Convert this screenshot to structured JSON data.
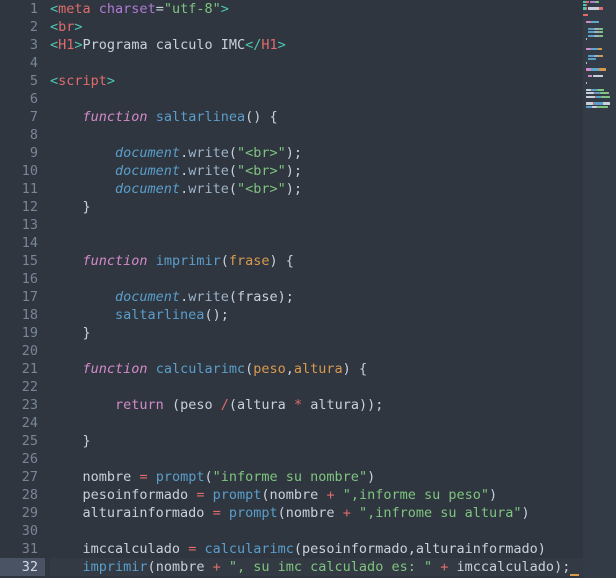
{
  "editor": {
    "name": "code-editor",
    "language": "html",
    "theme": "dark-slate",
    "total_lines": 32,
    "active_line": 32,
    "colors": {
      "background": "#2f3640",
      "gutter_text": "#7a8596",
      "active_line_number_bg": "#4a5364",
      "minimap_background": "#333b47",
      "cursor": "#d99a4e",
      "tag_bracket": "#4ec9b0",
      "tag_name": "#e06c6c",
      "attribute": "#b07ad6",
      "string": "#7fc47f",
      "keyword": "#d38ac9",
      "function_name": "#5fa8c9",
      "parameter": "#d99a4e",
      "operator": "#e06c6c",
      "plain_text": "#c8d0db"
    }
  },
  "line_numbers": [
    1,
    2,
    3,
    4,
    5,
    6,
    7,
    8,
    9,
    10,
    11,
    12,
    13,
    14,
    15,
    16,
    17,
    18,
    19,
    20,
    21,
    22,
    23,
    24,
    25,
    26,
    27,
    28,
    29,
    30,
    31,
    32
  ],
  "code_lines": [
    {
      "n": 1,
      "text": "<meta charset=\"utf-8\">"
    },
    {
      "n": 2,
      "text": "<br>"
    },
    {
      "n": 3,
      "text": "<H1>Programa calculo IMC</H1>"
    },
    {
      "n": 4,
      "text": ""
    },
    {
      "n": 5,
      "text": "<script>"
    },
    {
      "n": 6,
      "text": ""
    },
    {
      "n": 7,
      "text": "    function saltarlinea() {"
    },
    {
      "n": 8,
      "text": ""
    },
    {
      "n": 9,
      "text": "        document.write(\"<br>\");"
    },
    {
      "n": 10,
      "text": "        document.write(\"<br>\");"
    },
    {
      "n": 11,
      "text": "        document.write(\"<br>\");"
    },
    {
      "n": 12,
      "text": "    }"
    },
    {
      "n": 13,
      "text": ""
    },
    {
      "n": 14,
      "text": ""
    },
    {
      "n": 15,
      "text": "    function imprimir(frase) {"
    },
    {
      "n": 16,
      "text": ""
    },
    {
      "n": 17,
      "text": "        document.write(frase);"
    },
    {
      "n": 18,
      "text": "        saltarlinea();"
    },
    {
      "n": 19,
      "text": "    }"
    },
    {
      "n": 20,
      "text": ""
    },
    {
      "n": 21,
      "text": "    function calcularimc(peso,altura) {"
    },
    {
      "n": 22,
      "text": ""
    },
    {
      "n": 23,
      "text": "        return (peso /(altura * altura));"
    },
    {
      "n": 24,
      "text": ""
    },
    {
      "n": 25,
      "text": "    }"
    },
    {
      "n": 26,
      "text": ""
    },
    {
      "n": 27,
      "text": "    nombre = prompt(\"informe su nombre\")"
    },
    {
      "n": 28,
      "text": "    pesoinformado = prompt(nombre + \",informe su peso\")"
    },
    {
      "n": 29,
      "text": "    alturainformado = prompt(nombre + \",infrome su altura\")"
    },
    {
      "n": 30,
      "text": ""
    },
    {
      "n": 31,
      "text": "    imccalculado = calcularimc(pesoinformado,alturainformado)"
    },
    {
      "n": 32,
      "text": "    imprimir(nombre + \", su imc calculado es: \" + imccalculado);"
    }
  ],
  "minimap": {
    "name": "minimap",
    "visible_rows": 32,
    "rows": [
      [
        {
          "w": 3,
          "c": "#4ec9b0"
        },
        {
          "w": 4,
          "c": "#e06c6c"
        },
        {
          "w": 1,
          "c": "#2f3640"
        },
        {
          "w": 6,
          "c": "#b07ad6"
        },
        {
          "w": 5,
          "c": "#7fc47f"
        }
      ],
      [
        {
          "w": 3,
          "c": "#4ec9b0"
        },
        {
          "w": 2,
          "c": "#e06c6c"
        }
      ],
      [
        {
          "w": 3,
          "c": "#4ec9b0"
        },
        {
          "w": 2,
          "c": "#e06c6c"
        },
        {
          "w": 1,
          "c": "#2f3640"
        },
        {
          "w": 13,
          "c": "#c8d0db"
        },
        {
          "w": 4,
          "c": "#e06c6c"
        }
      ],
      [],
      [
        {
          "w": 6,
          "c": "#e06c6c"
        }
      ],
      [],
      [
        {
          "w": 3,
          "c": "#2f3640"
        },
        {
          "w": 6,
          "c": "#d38ac9"
        },
        {
          "w": 1,
          "c": "#2f3640"
        },
        {
          "w": 9,
          "c": "#5fa8c9"
        }
      ],
      [],
      [
        {
          "w": 6,
          "c": "#2f3640"
        },
        {
          "w": 7,
          "c": "#5a9ec9"
        },
        {
          "w": 6,
          "c": "#9fb3c8"
        },
        {
          "w": 4,
          "c": "#7fc47f"
        }
      ],
      [
        {
          "w": 6,
          "c": "#2f3640"
        },
        {
          "w": 7,
          "c": "#5a9ec9"
        },
        {
          "w": 6,
          "c": "#9fb3c8"
        },
        {
          "w": 4,
          "c": "#7fc47f"
        }
      ],
      [
        {
          "w": 6,
          "c": "#2f3640"
        },
        {
          "w": 7,
          "c": "#5a9ec9"
        },
        {
          "w": 6,
          "c": "#9fb3c8"
        },
        {
          "w": 4,
          "c": "#7fc47f"
        }
      ],
      [
        {
          "w": 3,
          "c": "#2f3640"
        },
        {
          "w": 1,
          "c": "#c8d0db"
        }
      ],
      [],
      [],
      [
        {
          "w": 3,
          "c": "#2f3640"
        },
        {
          "w": 6,
          "c": "#d38ac9"
        },
        {
          "w": 1,
          "c": "#2f3640"
        },
        {
          "w": 8,
          "c": "#5fa8c9"
        },
        {
          "w": 4,
          "c": "#d99a4e"
        }
      ],
      [],
      [
        {
          "w": 6,
          "c": "#2f3640"
        },
        {
          "w": 7,
          "c": "#5a9ec9"
        },
        {
          "w": 6,
          "c": "#9fb3c8"
        },
        {
          "w": 4,
          "c": "#d99a4e"
        }
      ],
      [
        {
          "w": 6,
          "c": "#2f3640"
        },
        {
          "w": 9,
          "c": "#5a9ec9"
        }
      ],
      [
        {
          "w": 3,
          "c": "#2f3640"
        },
        {
          "w": 1,
          "c": "#c8d0db"
        }
      ],
      [],
      [
        {
          "w": 3,
          "c": "#2f3640"
        },
        {
          "w": 6,
          "c": "#d38ac9"
        },
        {
          "w": 1,
          "c": "#2f3640"
        },
        {
          "w": 9,
          "c": "#5fa8c9"
        },
        {
          "w": 8,
          "c": "#d99a4e"
        }
      ],
      [],
      [
        {
          "w": 6,
          "c": "#2f3640"
        },
        {
          "w": 5,
          "c": "#d38ac9"
        },
        {
          "w": 1,
          "c": "#2f3640"
        },
        {
          "w": 12,
          "c": "#c8d0db"
        }
      ],
      [],
      [
        {
          "w": 3,
          "c": "#2f3640"
        },
        {
          "w": 1,
          "c": "#c8d0db"
        }
      ],
      [],
      [
        {
          "w": 3,
          "c": "#2f3640"
        },
        {
          "w": 6,
          "c": "#c8d0db"
        },
        {
          "w": 1,
          "c": "#e06c6c"
        },
        {
          "w": 6,
          "c": "#5a9ec9"
        },
        {
          "w": 9,
          "c": "#7fc47f"
        }
      ],
      [
        {
          "w": 3,
          "c": "#2f3640"
        },
        {
          "w": 10,
          "c": "#c8d0db"
        },
        {
          "w": 1,
          "c": "#e06c6c"
        },
        {
          "w": 6,
          "c": "#5a9ec9"
        },
        {
          "w": 11,
          "c": "#7fc47f"
        }
      ],
      [
        {
          "w": 3,
          "c": "#2f3640"
        },
        {
          "w": 11,
          "c": "#c8d0db"
        },
        {
          "w": 1,
          "c": "#e06c6c"
        },
        {
          "w": 6,
          "c": "#5a9ec9"
        },
        {
          "w": 11,
          "c": "#7fc47f"
        }
      ],
      [],
      [
        {
          "w": 3,
          "c": "#2f3640"
        },
        {
          "w": 9,
          "c": "#c8d0db"
        },
        {
          "w": 1,
          "c": "#e06c6c"
        },
        {
          "w": 10,
          "c": "#5a9ec9"
        },
        {
          "w": 9,
          "c": "#c8d0db"
        }
      ],
      [
        {
          "w": 3,
          "c": "#2f3640"
        },
        {
          "w": 8,
          "c": "#5a9ec9"
        },
        {
          "w": 6,
          "c": "#c8d0db"
        },
        {
          "w": 12,
          "c": "#7fc47f"
        }
      ]
    ]
  }
}
